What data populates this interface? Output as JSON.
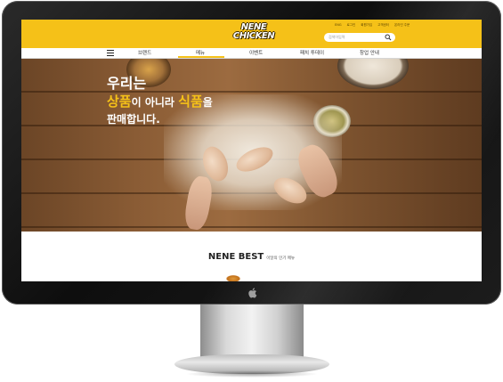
{
  "header": {
    "logo_line1": "NENE",
    "logo_line2": "CHICKEN",
    "util_links": [
      "ENG",
      "로그인",
      "회원가입",
      "고객센터",
      "온라인 주문"
    ],
    "search_placeholder": "검색어입력"
  },
  "nav": {
    "items": [
      "브랜드",
      "메뉴",
      "이벤트",
      "패치 투데이",
      "창업 안내"
    ],
    "active": "메뉴"
  },
  "hero": {
    "line1": "우리는",
    "line2_a": "상품",
    "line2_b": "이 아니라 ",
    "line2_c": "식품",
    "line2_d": "을",
    "line3": "판매합니다."
  },
  "best": {
    "title": "NENE BEST",
    "subtitle": "이달의 인기 메뉴"
  },
  "icons": {
    "search": "search-icon",
    "menu": "hamburger-menu-icon",
    "brand": "apple-logo-icon"
  },
  "colors": {
    "brand_yellow": "#f5c118",
    "monitor_bezel": "#111111"
  }
}
